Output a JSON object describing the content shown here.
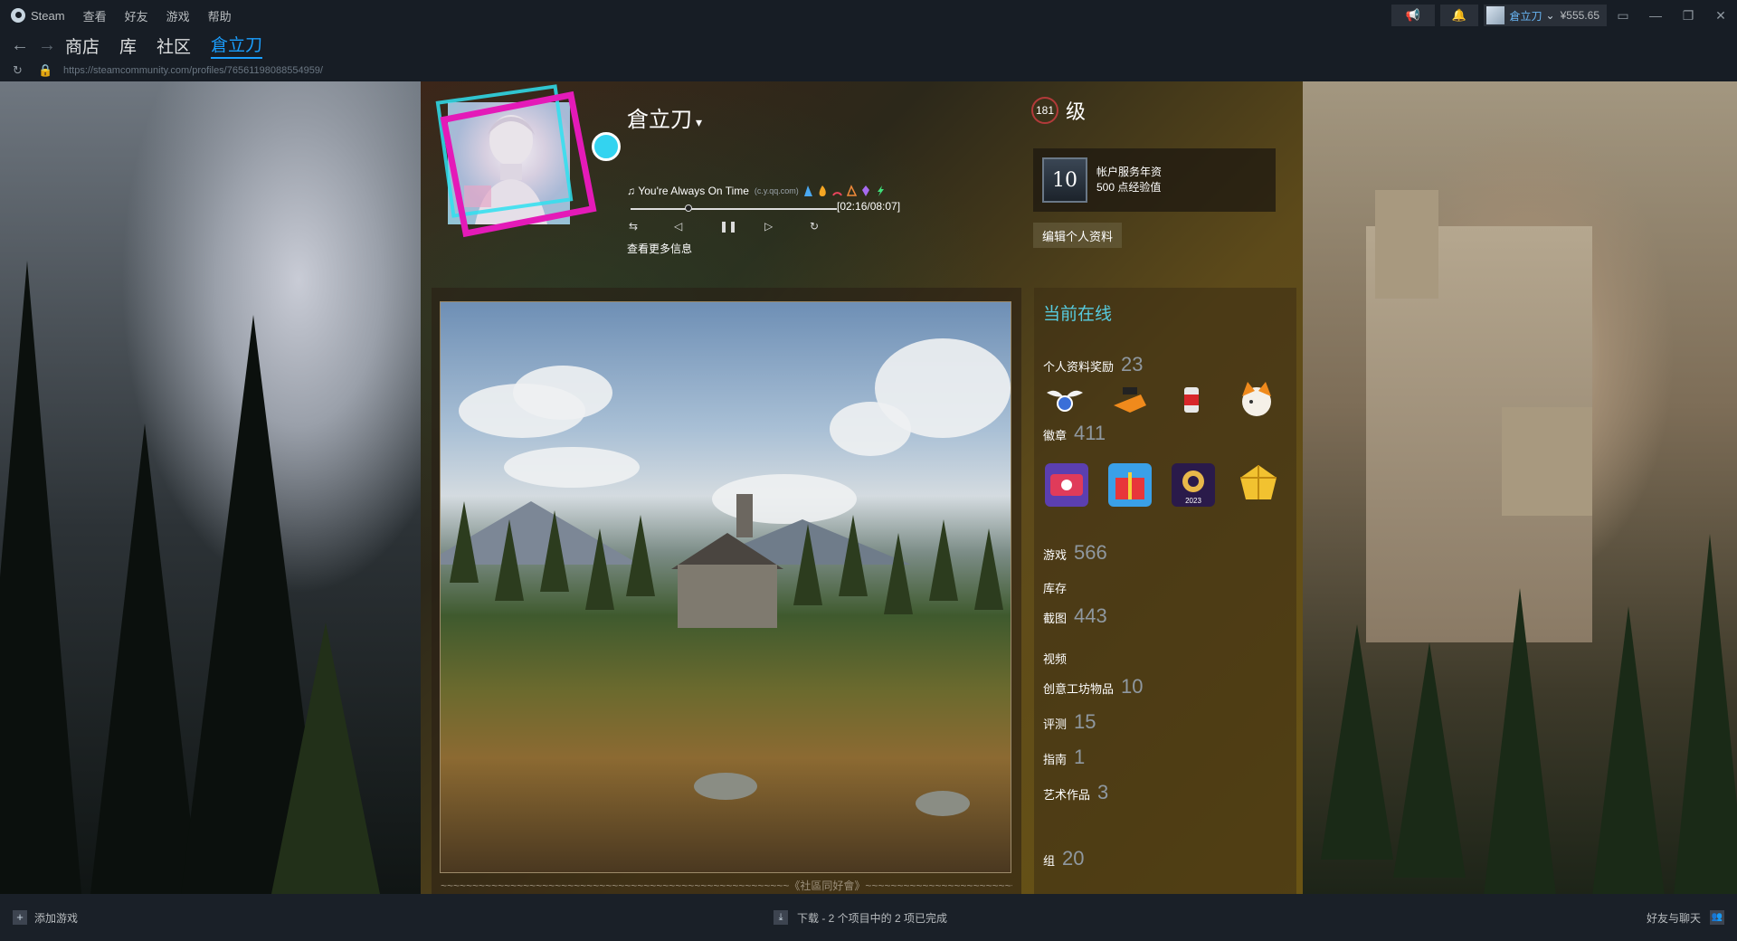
{
  "titlebar": {
    "menu": [
      "Steam",
      "查看",
      "好友",
      "游戏",
      "帮助"
    ],
    "account_name": "倉立刀",
    "balance": "¥555.65"
  },
  "nav": {
    "links": [
      "商店",
      "库",
      "社区",
      "倉立刀"
    ],
    "active_index": 3
  },
  "url": "https://steamcommunity.com/profiles/76561198088554959/",
  "profile": {
    "persona_name": "倉立刀",
    "music": {
      "title": "You're Always On Time",
      "source": "(c.y.qq.com)",
      "time": "[02:16/08:07]",
      "progress_fraction": 0.28
    },
    "more_info": "查看更多信息",
    "level": "181",
    "level_label": "级",
    "years_badge": "10",
    "years_title": "帐户服务年资",
    "years_xp": "500 点经验值",
    "edit_button": "编辑个人资料",
    "group_caption": "~~~~~~~~~~~~~~~~~~~~~~~~~~~~~~~~~~~~~~~~~~~~~~~~~~~~~~~《社區同好會》~~~~~~~~~~~~~~~~~~~~~~~~~~~~~~~~~~~~~~~~~~~~~~~~~~~~~~"
  },
  "sidebar": {
    "online_status": "当前在线",
    "rewards_label": "个人资料奖励",
    "rewards_count": "23",
    "badges_label": "徽章",
    "badges_count": "411",
    "games_label": "游戏",
    "games_count": "566",
    "inventory_label": "库存",
    "screenshots_label": "截图",
    "screenshots_count": "443",
    "videos_label": "视频",
    "workshop_label": "创意工坊物品",
    "workshop_count": "10",
    "reviews_label": "评测",
    "reviews_count": "15",
    "guides_label": "指南",
    "guides_count": "1",
    "artwork_label": "艺术作品",
    "artwork_count": "3",
    "groups_label": "组",
    "groups_count": "20"
  },
  "bottombar": {
    "add_game": "添加游戏",
    "downloads": "下载 - 2 个项目中的 2 项已完成",
    "friends_chat": "好友与聊天"
  },
  "colors": {
    "accent": "#1a9fff",
    "online": "#57cbde",
    "avatar_frame": "#e41ab8"
  }
}
